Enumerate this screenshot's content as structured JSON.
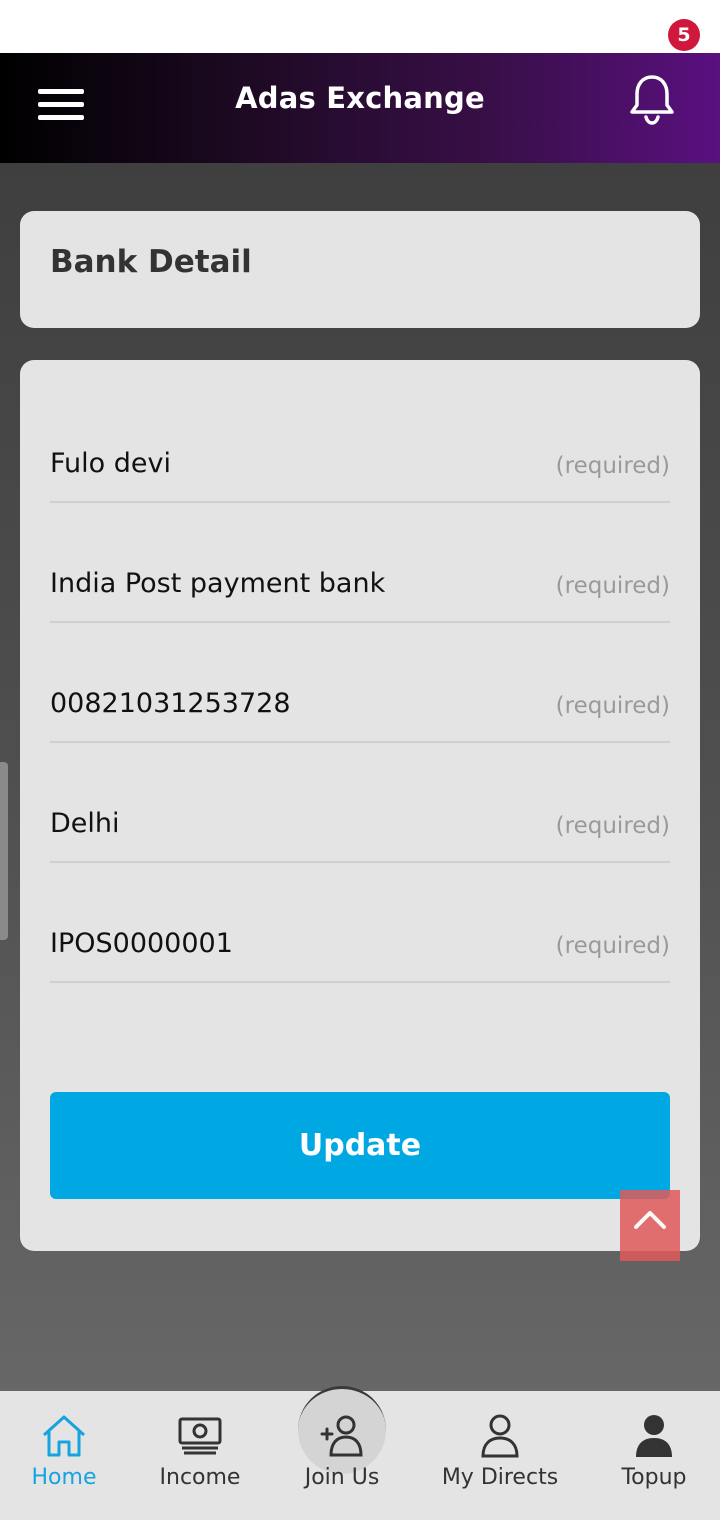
{
  "header": {
    "title": "Adas Exchange",
    "notification_count": "5",
    "menu_icon": "hamburger-menu-icon",
    "bell_icon": "bell-icon"
  },
  "page": {
    "title": "Bank Detail"
  },
  "form": {
    "fields": [
      {
        "value": "Fulo devi",
        "hint": "(required)"
      },
      {
        "value": "India Post payment bank",
        "hint": "(required)"
      },
      {
        "value": "00821031253728",
        "hint": "(required)"
      },
      {
        "value": "Delhi",
        "hint": "(required)"
      },
      {
        "value": "IPOS0000001",
        "hint": "(required)"
      }
    ],
    "submit_label": "Update"
  },
  "bottom_nav": {
    "items": [
      {
        "label": "Home",
        "icon": "home-icon",
        "active": true
      },
      {
        "label": "Income",
        "icon": "cash-icon",
        "active": false
      },
      {
        "label": "Join Us",
        "icon": "add-user-icon",
        "active": false
      },
      {
        "label": "My Directs",
        "icon": "user-outline-icon",
        "active": false
      },
      {
        "label": "Topup",
        "icon": "user-filled-icon",
        "active": false
      }
    ]
  },
  "colors": {
    "accent": "#00a8e3",
    "badge": "#d0173c",
    "active_nav": "#16a3e0",
    "scroll_top": "#e05a5a"
  }
}
